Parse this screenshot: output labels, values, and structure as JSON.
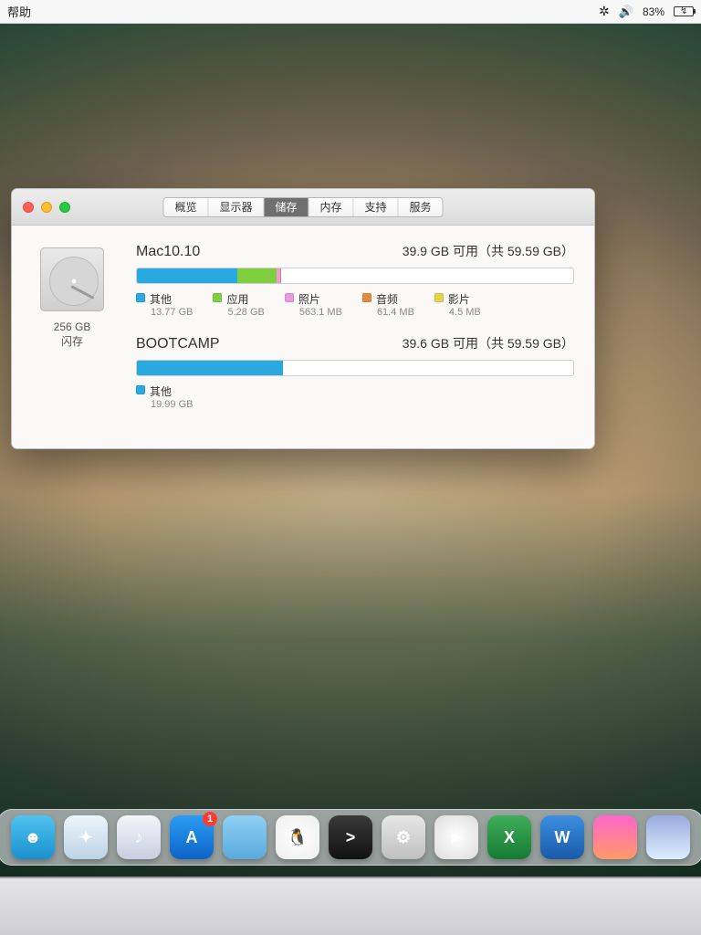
{
  "menubar": {
    "help_label": "帮助",
    "battery_percent": "83%"
  },
  "tabs": [
    {
      "label": "概览"
    },
    {
      "label": "显示器"
    },
    {
      "label": "储存"
    },
    {
      "label": "内存"
    },
    {
      "label": "支持"
    },
    {
      "label": "服务"
    }
  ],
  "active_tab_index": 2,
  "drive": {
    "capacity": "256 GB",
    "type": "闪存"
  },
  "volumes": [
    {
      "name": "Mac10.10",
      "summary": "39.9 GB 可用（共 59.59 GB）",
      "total_gb": 59.59,
      "segments": [
        {
          "label": "其他",
          "value": "13.77 GB",
          "gb": 13.77,
          "color": "#2aa8e0"
        },
        {
          "label": "应用",
          "value": "5.28 GB",
          "gb": 5.28,
          "color": "#7fcf3e"
        },
        {
          "label": "照片",
          "value": "563.1 MB",
          "gb": 0.5631,
          "color": "#e79adf"
        },
        {
          "label": "音频",
          "value": "61.4 MB",
          "gb": 0.0614,
          "color": "#e8893a"
        },
        {
          "label": "影片",
          "value": "4.5 MB",
          "gb": 0.0045,
          "color": "#e7d24a"
        }
      ]
    },
    {
      "name": "BOOTCAMP",
      "summary": "39.6 GB 可用（共 59.59 GB）",
      "total_gb": 59.59,
      "segments": [
        {
          "label": "其他",
          "value": "19.99 GB",
          "gb": 19.99,
          "color": "#2aa8e0"
        }
      ]
    }
  ],
  "dock": [
    {
      "name": "finder",
      "glyph": "☻",
      "bg": "linear-gradient(#4fc4ef,#1a8fce)",
      "badge": null
    },
    {
      "name": "safari",
      "glyph": "✦",
      "bg": "linear-gradient(#eef5fb,#bcd3e6)",
      "badge": null
    },
    {
      "name": "itunes",
      "glyph": "♪",
      "bg": "linear-gradient(#f2f5fa,#c8cfe0)",
      "badge": null
    },
    {
      "name": "app-store",
      "glyph": "A",
      "bg": "linear-gradient(#2a9df4,#0d63c7)",
      "badge": "1"
    },
    {
      "name": "folder",
      "glyph": "",
      "bg": "linear-gradient(#8fd0f4,#5aa9dd)",
      "badge": null
    },
    {
      "name": "qq",
      "glyph": "🐧",
      "bg": "radial-gradient(circle,#fff,#eee)",
      "badge": null
    },
    {
      "name": "terminal",
      "glyph": ">",
      "bg": "linear-gradient(#3a3a3a,#111)",
      "badge": null
    },
    {
      "name": "settings",
      "glyph": "⚙",
      "bg": "linear-gradient(#e7e7e7,#bfbfbf)",
      "badge": null
    },
    {
      "name": "media-player",
      "glyph": "►",
      "bg": "radial-gradient(circle,#fff,#ddd)",
      "badge": null
    },
    {
      "name": "excel",
      "glyph": "X",
      "bg": "linear-gradient(#3fae5a,#157a33)",
      "badge": null
    },
    {
      "name": "word",
      "glyph": "W",
      "bg": "linear-gradient(#3d8fe0,#185aa8)",
      "badge": null
    },
    {
      "name": "game-1",
      "glyph": "",
      "bg": "linear-gradient(#f6c,#f96)",
      "badge": null
    },
    {
      "name": "game-2",
      "glyph": "",
      "bg": "linear-gradient(#9ad,#def)",
      "badge": null
    }
  ]
}
